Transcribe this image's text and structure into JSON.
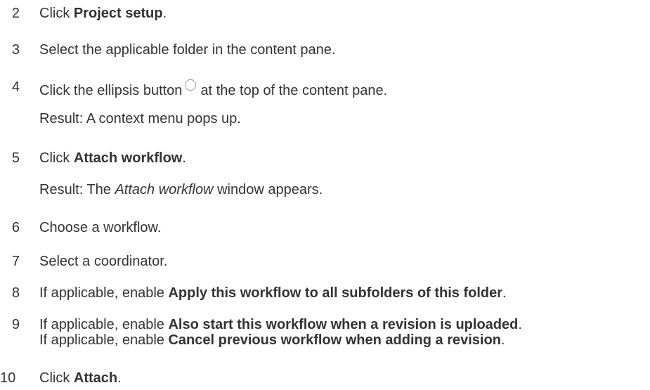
{
  "steps": [
    {
      "num": "2",
      "pre": "Click ",
      "bold": "Project setup",
      "post": "."
    },
    {
      "num": "3",
      "text": "Select the applicable folder in the content pane."
    },
    {
      "num": "4",
      "pre": "Click the ellipsis button",
      "post": "at the top of the content pane.",
      "icon": "ellipsis-circle-icon",
      "result": "Result: A context menu pops up."
    },
    {
      "num": "5",
      "pre": "Click ",
      "bold": "Attach workflow",
      "post": ".",
      "result_pre": "Result: The ",
      "result_italic": "Attach workflow",
      "result_post": " window appears."
    },
    {
      "num": "6",
      "text": "Choose a workflow."
    },
    {
      "num": "7",
      "text": "Select a coordinator."
    },
    {
      "num": "8",
      "pre": "If applicable, enable ",
      "bold": "Apply this workflow to all subfolders of this folder",
      "post": "."
    },
    {
      "num": "9",
      "line1_pre": "If applicable, enable ",
      "line1_bold": "Also start this workflow when a revision is uploaded",
      "line1_post": ".",
      "line2_pre": "If applicable, enable ",
      "line2_bold": "Cancel previous workflow when adding a revision",
      "line2_post": "."
    },
    {
      "num": "10",
      "pre": "Click ",
      "bold": "Attach",
      "post": "."
    }
  ]
}
